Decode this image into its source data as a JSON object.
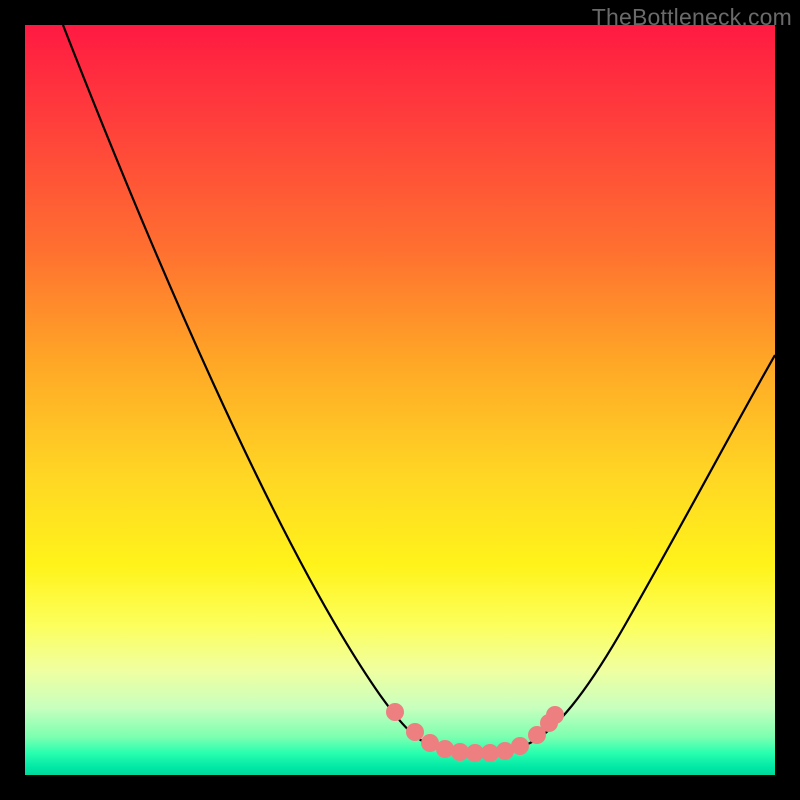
{
  "watermark": "TheBottleneck.com",
  "chart_data": {
    "type": "line",
    "title": "",
    "xlabel": "",
    "ylabel": "",
    "xlim": [
      0,
      100
    ],
    "ylim": [
      0,
      100
    ],
    "series": [
      {
        "name": "bottleneck-curve",
        "x": [
          5,
          10,
          15,
          20,
          25,
          30,
          35,
          40,
          45,
          50,
          55,
          58,
          60,
          62,
          65,
          70,
          75,
          80,
          85,
          90,
          95,
          100
        ],
        "values": [
          100,
          92,
          84,
          76,
          67,
          58,
          49,
          40,
          31,
          22,
          13,
          7,
          4,
          3,
          3,
          4,
          8,
          15,
          24,
          33,
          42,
          51
        ]
      }
    ],
    "markers": {
      "name": "highlight-points",
      "x": [
        50,
        53,
        55,
        57,
        59,
        61,
        63,
        65,
        67,
        69,
        70
      ],
      "values": [
        13,
        10,
        8,
        6,
        4,
        3,
        3,
        3,
        4,
        6,
        8
      ],
      "color": "#ee7f81"
    },
    "gradient_stops": [
      {
        "pos": 0,
        "color": "#ff1a42"
      },
      {
        "pos": 50,
        "color": "#ffd624"
      },
      {
        "pos": 80,
        "color": "#fcff5c"
      },
      {
        "pos": 100,
        "color": "#00d898"
      }
    ]
  }
}
